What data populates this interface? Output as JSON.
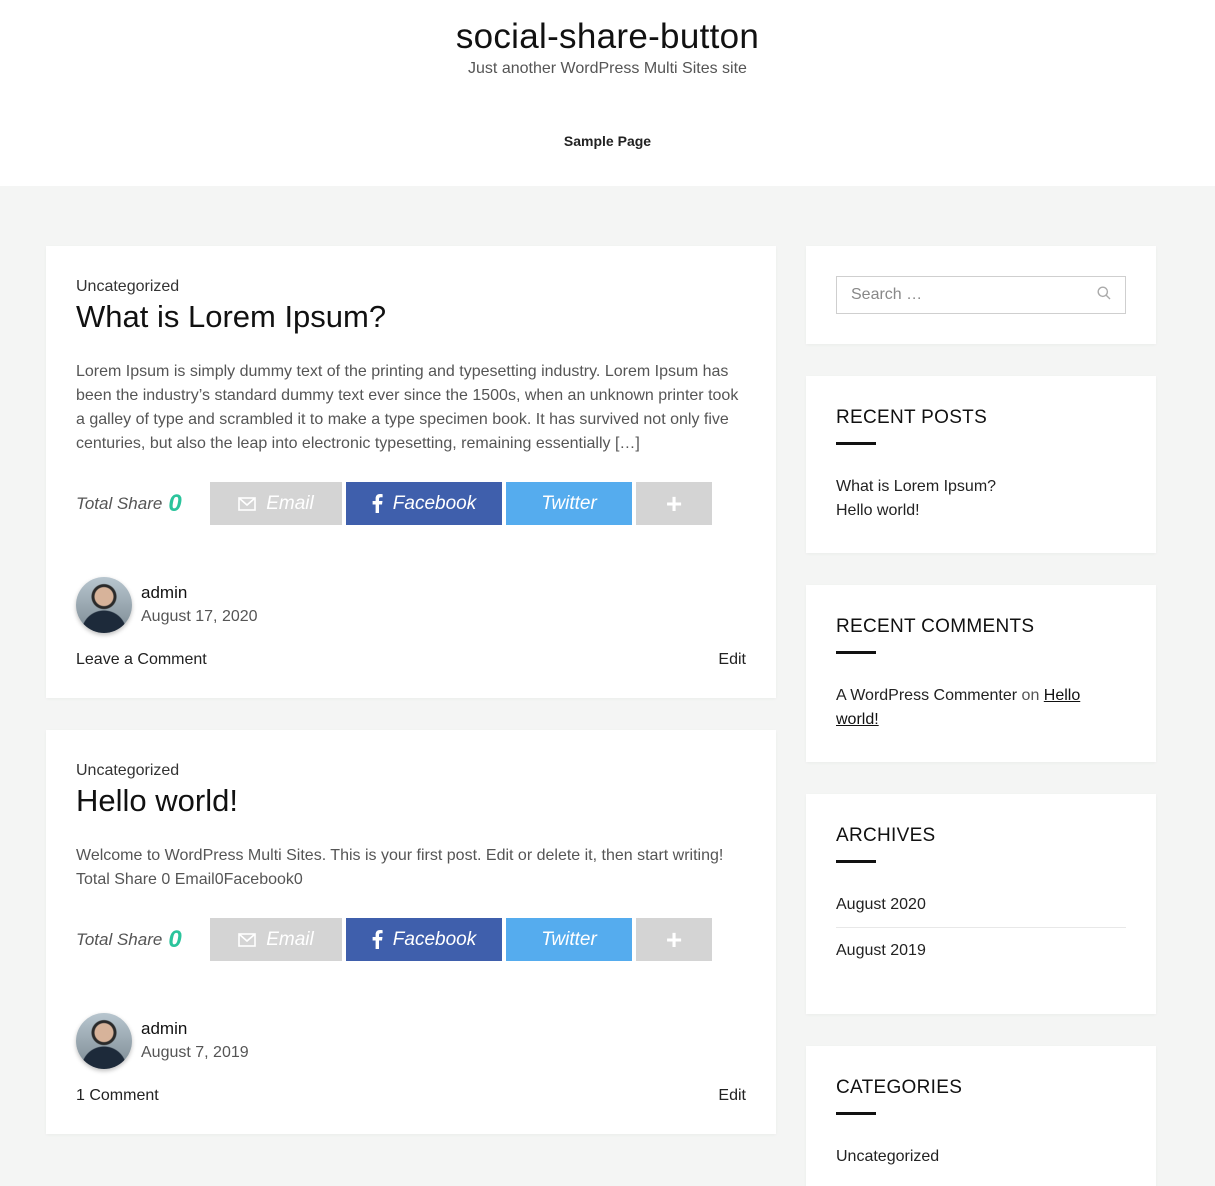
{
  "site": {
    "title": "social-share-button",
    "description": "Just another WordPress Multi Sites site",
    "nav": [
      "Sample Page"
    ]
  },
  "posts": [
    {
      "category": "Uncategorized",
      "title": "What is Lorem Ipsum?",
      "excerpt": "Lorem Ipsum is simply dummy text of the printing and typesetting industry. Lorem Ipsum has been the industry’s standard dummy text ever since the 1500s, when an unknown printer took a galley of type and scrambled it to make a type specimen book. It has survived not only five centuries, but also the leap into electronic typesetting, remaining essentially […]",
      "share": {
        "total_label": "Total Share",
        "total_count": "0",
        "email": "Email",
        "facebook": "Facebook",
        "twitter": "Twitter",
        "more": "+"
      },
      "author": "admin",
      "date": "August 17, 2020",
      "comments": "Leave a Comment",
      "edit": "Edit"
    },
    {
      "category": "Uncategorized",
      "title": "Hello world!",
      "excerpt": "Welcome to WordPress Multi Sites. This is your first post. Edit or delete it, then start writing! Total Share 0 Email0Facebook0",
      "share": {
        "total_label": "Total Share",
        "total_count": "0",
        "email": "Email",
        "facebook": "Facebook",
        "twitter": "Twitter",
        "more": "+"
      },
      "author": "admin",
      "date": "August 7, 2019",
      "comments": "1 Comment",
      "edit": "Edit"
    }
  ],
  "sidebar": {
    "search_placeholder": "Search …",
    "recent_posts": {
      "title": "RECENT POSTS",
      "items": [
        "What is Lorem Ipsum?",
        "Hello world!"
      ]
    },
    "recent_comments": {
      "title": "RECENT COMMENTS",
      "author": "A WordPress Commenter",
      "on": "on",
      "post": "Hello world!"
    },
    "archives": {
      "title": "ARCHIVES",
      "items": [
        "August 2020",
        "August 2019"
      ]
    },
    "categories": {
      "title": "CATEGORIES",
      "items": [
        "Uncategorized"
      ]
    }
  },
  "colors": {
    "facebook": "#3f5fac",
    "twitter": "#55acee",
    "email": "#d4d4d4",
    "share_count": "#2bc49c"
  }
}
